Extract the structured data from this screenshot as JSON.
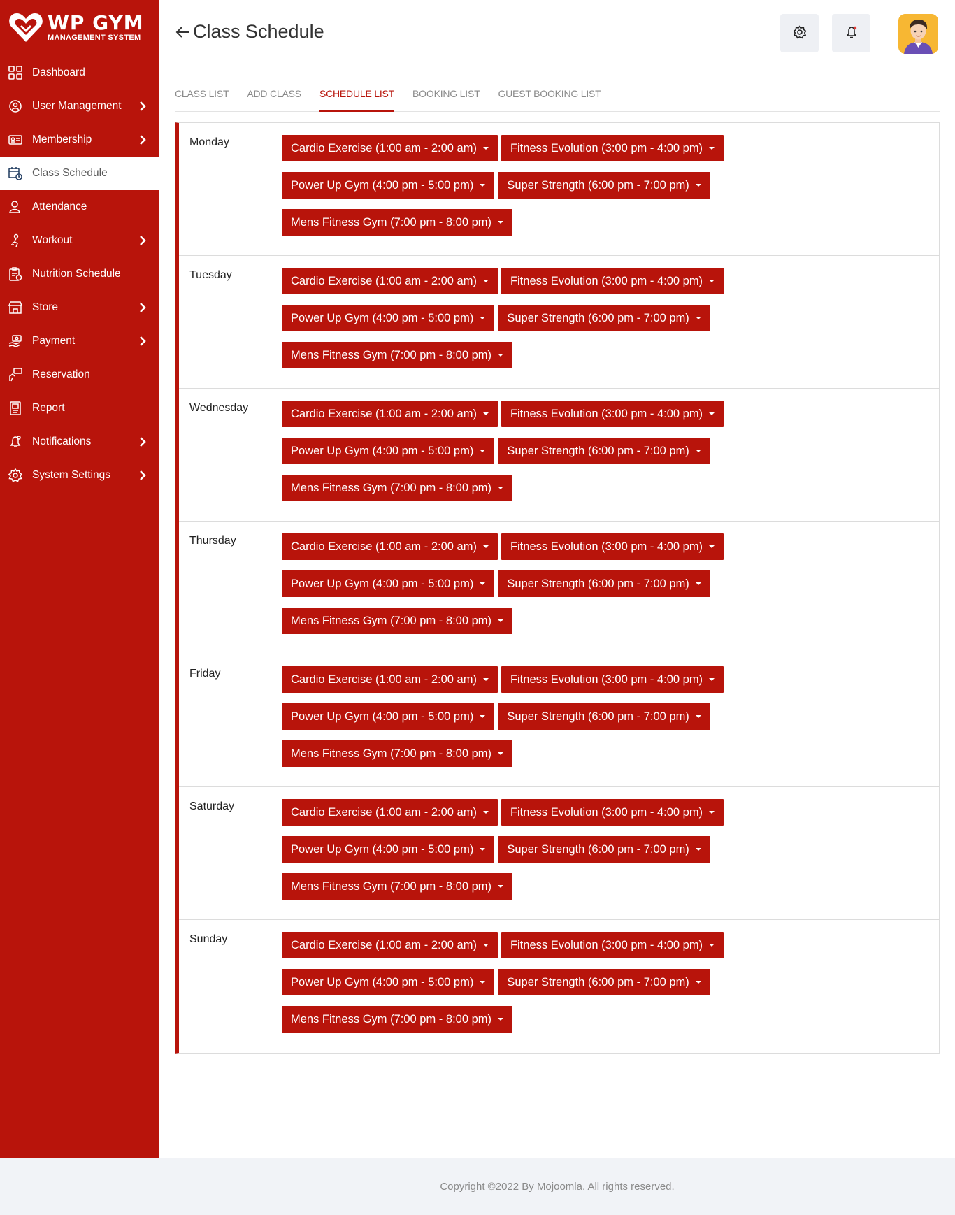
{
  "brand": {
    "title": "WP GYM",
    "subtitle": "MANAGEMENT SYSTEM"
  },
  "sidebar": {
    "items": [
      {
        "label": "Dashboard",
        "icon": "dashboard-icon",
        "has_submenu": false,
        "active": false
      },
      {
        "label": "User Management",
        "icon": "users-gear-icon",
        "has_submenu": true,
        "active": false
      },
      {
        "label": "Membership",
        "icon": "membership-card-icon",
        "has_submenu": true,
        "active": false
      },
      {
        "label": "Class Schedule",
        "icon": "calendar-clock-icon",
        "has_submenu": false,
        "active": true
      },
      {
        "label": "Attendance",
        "icon": "user-check-icon",
        "has_submenu": false,
        "active": false
      },
      {
        "label": "Workout",
        "icon": "workout-icon",
        "has_submenu": true,
        "active": false
      },
      {
        "label": "Nutrition Schedule",
        "icon": "nutrition-icon",
        "has_submenu": false,
        "active": false
      },
      {
        "label": "Store",
        "icon": "store-icon",
        "has_submenu": true,
        "active": false
      },
      {
        "label": "Payment",
        "icon": "payment-icon",
        "has_submenu": true,
        "active": false
      },
      {
        "label": "Reservation",
        "icon": "reservation-icon",
        "has_submenu": false,
        "active": false
      },
      {
        "label": "Report",
        "icon": "report-icon",
        "has_submenu": false,
        "active": false
      },
      {
        "label": "Notifications",
        "icon": "bell-icon",
        "has_submenu": true,
        "active": false
      },
      {
        "label": "System Settings",
        "icon": "gear-icon",
        "has_submenu": true,
        "active": false
      }
    ]
  },
  "header": {
    "title": "Class Schedule"
  },
  "tabs": [
    {
      "label": "CLASS LIST",
      "active": false
    },
    {
      "label": "ADD CLASS",
      "active": false
    },
    {
      "label": "SCHEDULE LIST",
      "active": true
    },
    {
      "label": "BOOKING LIST",
      "active": false
    },
    {
      "label": "GUEST BOOKING LIST",
      "active": false
    }
  ],
  "schedule": {
    "days": [
      {
        "name": "Monday",
        "classes": [
          "Cardio Exercise (1:00 am - 2:00 am)",
          "Fitness Evolution (3:00 pm - 4:00 pm)",
          "Power Up Gym (4:00 pm - 5:00 pm)",
          "Super Strength (6:00 pm - 7:00 pm)",
          "Mens Fitness Gym (7:00 pm - 8:00 pm)"
        ]
      },
      {
        "name": "Tuesday",
        "classes": [
          "Cardio Exercise (1:00 am - 2:00 am)",
          "Fitness Evolution (3:00 pm - 4:00 pm)",
          "Power Up Gym (4:00 pm - 5:00 pm)",
          "Super Strength (6:00 pm - 7:00 pm)",
          "Mens Fitness Gym (7:00 pm - 8:00 pm)"
        ]
      },
      {
        "name": "Wednesday",
        "classes": [
          "Cardio Exercise (1:00 am - 2:00 am)",
          "Fitness Evolution (3:00 pm - 4:00 pm)",
          "Power Up Gym (4:00 pm - 5:00 pm)",
          "Super Strength (6:00 pm - 7:00 pm)",
          "Mens Fitness Gym (7:00 pm - 8:00 pm)"
        ]
      },
      {
        "name": "Thursday",
        "classes": [
          "Cardio Exercise (1:00 am - 2:00 am)",
          "Fitness Evolution (3:00 pm - 4:00 pm)",
          "Power Up Gym (4:00 pm - 5:00 pm)",
          "Super Strength (6:00 pm - 7:00 pm)",
          "Mens Fitness Gym (7:00 pm - 8:00 pm)"
        ]
      },
      {
        "name": "Friday",
        "classes": [
          "Cardio Exercise (1:00 am - 2:00 am)",
          "Fitness Evolution (3:00 pm - 4:00 pm)",
          "Power Up Gym (4:00 pm - 5:00 pm)",
          "Super Strength (6:00 pm - 7:00 pm)",
          "Mens Fitness Gym (7:00 pm - 8:00 pm)"
        ]
      },
      {
        "name": "Saturday",
        "classes": [
          "Cardio Exercise (1:00 am - 2:00 am)",
          "Fitness Evolution (3:00 pm - 4:00 pm)",
          "Power Up Gym (4:00 pm - 5:00 pm)",
          "Super Strength (6:00 pm - 7:00 pm)",
          "Mens Fitness Gym (7:00 pm - 8:00 pm)"
        ]
      },
      {
        "name": "Sunday",
        "classes": [
          "Cardio Exercise (1:00 am - 2:00 am)",
          "Fitness Evolution (3:00 pm - 4:00 pm)",
          "Power Up Gym (4:00 pm - 5:00 pm)",
          "Super Strength (6:00 pm - 7:00 pm)",
          "Mens Fitness Gym (7:00 pm - 8:00 pm)"
        ]
      }
    ]
  },
  "footer": {
    "text": "Copyright ©2022 By Mojoomla. All rights reserved."
  },
  "colors": {
    "brand_red": "#b8140b",
    "footer_bg": "#f1f3f7",
    "active_menu_bg": "#ffffff"
  }
}
